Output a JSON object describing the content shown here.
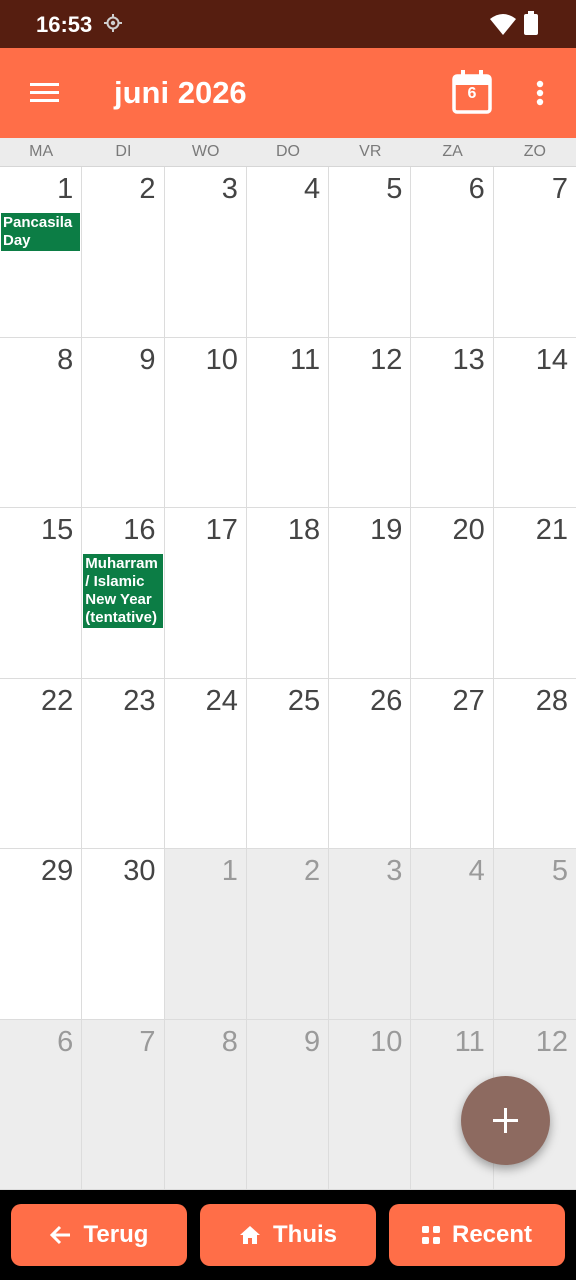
{
  "status_bar": {
    "time": "16:53"
  },
  "app_bar": {
    "title": "juni 2026",
    "today_number": "6"
  },
  "weekdays": [
    "MA",
    "DI",
    "WO",
    "DO",
    "VR",
    "ZA",
    "ZO"
  ],
  "weeks": [
    [
      {
        "day": "1",
        "other": false,
        "event": "Pancasila Day"
      },
      {
        "day": "2",
        "other": false
      },
      {
        "day": "3",
        "other": false
      },
      {
        "day": "4",
        "other": false
      },
      {
        "day": "5",
        "other": false
      },
      {
        "day": "6",
        "other": false
      },
      {
        "day": "7",
        "other": false
      }
    ],
    [
      {
        "day": "8",
        "other": false
      },
      {
        "day": "9",
        "other": false
      },
      {
        "day": "10",
        "other": false
      },
      {
        "day": "11",
        "other": false
      },
      {
        "day": "12",
        "other": false
      },
      {
        "day": "13",
        "other": false
      },
      {
        "day": "14",
        "other": false
      }
    ],
    [
      {
        "day": "15",
        "other": false
      },
      {
        "day": "16",
        "other": false,
        "event": "Muharram / Islamic New Year (tentative)"
      },
      {
        "day": "17",
        "other": false
      },
      {
        "day": "18",
        "other": false
      },
      {
        "day": "19",
        "other": false
      },
      {
        "day": "20",
        "other": false
      },
      {
        "day": "21",
        "other": false
      }
    ],
    [
      {
        "day": "22",
        "other": false
      },
      {
        "day": "23",
        "other": false
      },
      {
        "day": "24",
        "other": false
      },
      {
        "day": "25",
        "other": false
      },
      {
        "day": "26",
        "other": false
      },
      {
        "day": "27",
        "other": false
      },
      {
        "day": "28",
        "other": false
      }
    ],
    [
      {
        "day": "29",
        "other": false
      },
      {
        "day": "30",
        "other": false
      },
      {
        "day": "1",
        "other": true
      },
      {
        "day": "2",
        "other": true
      },
      {
        "day": "3",
        "other": true
      },
      {
        "day": "4",
        "other": true
      },
      {
        "day": "5",
        "other": true
      }
    ],
    [
      {
        "day": "6",
        "other": true
      },
      {
        "day": "7",
        "other": true
      },
      {
        "day": "8",
        "other": true
      },
      {
        "day": "9",
        "other": true
      },
      {
        "day": "10",
        "other": true
      },
      {
        "day": "11",
        "other": true
      },
      {
        "day": "12",
        "other": true
      }
    ]
  ],
  "bottom_nav": {
    "back_label": "Terug",
    "home_label": "Thuis",
    "recent_label": "Recent"
  },
  "colors": {
    "status_bar": "#561e10",
    "accent": "#ff6e48",
    "event": "#0c7d45",
    "fab": "#8d6a60"
  },
  "icons": {
    "menu": "menu-icon",
    "today": "calendar-today-icon",
    "more": "more-vert-icon",
    "fab": "plus-icon",
    "back": "arrow-left-icon",
    "home": "home-icon",
    "recent": "grid-icon"
  }
}
